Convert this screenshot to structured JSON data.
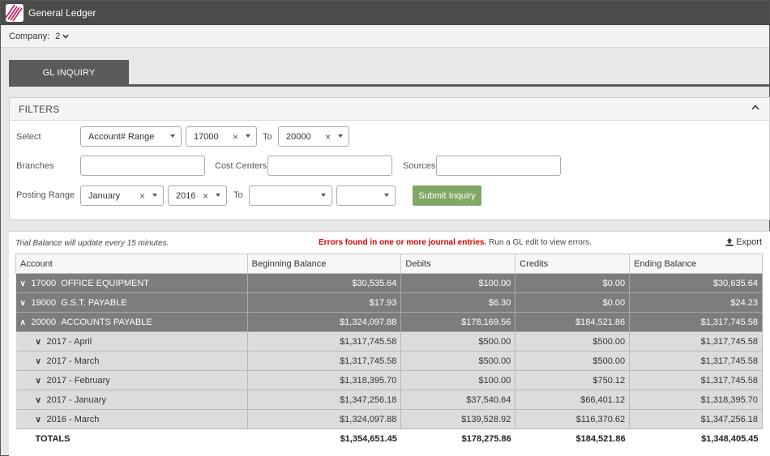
{
  "app": {
    "title": "General Ledger"
  },
  "company": {
    "label": "Company:",
    "value": "2"
  },
  "tabs": [
    {
      "label": "GL INQUIRY"
    }
  ],
  "filters": {
    "title": "FILTERS",
    "select_label": "Select",
    "select_type": "Account# Range",
    "from_value": "17000",
    "to_label": "To",
    "to_value": "20000",
    "branches_label": "Branches",
    "branches_value": "",
    "cost_centers_label": "Cost Centers",
    "cost_centers_value": "",
    "sources_label": "Sources",
    "sources_value": "",
    "posting_range_label": "Posting Range",
    "posting_month": "January",
    "posting_year": "2016",
    "posting_to_label": "To",
    "posting_to_month": "",
    "posting_to_year": "",
    "submit_label": "Submit Inquiry",
    "clear_glyph": "×"
  },
  "results": {
    "info_text": "Trial Balance will update every 15 minutes.",
    "error_text": "Errors found in one or more journal entries.",
    "error_rest": " Run a GL edit to view errors.",
    "export_label": "Export",
    "columns": [
      "Account",
      "Beginning Balance",
      "Debits",
      "Credits",
      "Ending Balance"
    ],
    "rows": [
      {
        "account": "17000",
        "name": "OFFICE EQUIPMENT",
        "beginning": "$30,535.64",
        "debits": "$100.00",
        "credits": "$0.00",
        "ending": "$30,635.64"
      },
      {
        "account": "19000",
        "name": "G.S.T. PAYABLE",
        "beginning": "$17.93",
        "debits": "$6.30",
        "credits": "$0.00",
        "ending": "$24.23"
      },
      {
        "account": "20000",
        "name": "ACCOUNTS PAYABLE",
        "beginning": "$1,324,097.88",
        "debits": "$178,169.56",
        "credits": "$184,521.86",
        "ending": "$1,317,745.58"
      }
    ],
    "months": [
      {
        "period": "2017 - April",
        "beginning": "$1,317,745.58",
        "debits": "$500.00",
        "credits": "$500.00",
        "ending": "$1,317,745.58"
      },
      {
        "period": "2017 - March",
        "beginning": "$1,317,745.58",
        "debits": "$500.00",
        "credits": "$500.00",
        "ending": "$1,317,745.58"
      },
      {
        "period": "2017 - February",
        "beginning": "$1,318,395.70",
        "debits": "$100.00",
        "credits": "$750.12",
        "ending": "$1,317,745.58"
      },
      {
        "period": "2017 - January",
        "beginning": "$1,347,256.18",
        "debits": "$37,540.64",
        "credits": "$66,401.12",
        "ending": "$1,318,395.70"
      },
      {
        "period": "2016 - March",
        "beginning": "$1,324,097.88",
        "debits": "$139,528.92",
        "credits": "$116,370.62",
        "ending": "$1,347,256.18"
      }
    ],
    "totals": {
      "label": "TOTALS",
      "beginning": "$1,354,651.45",
      "debits": "$178,275.86",
      "credits": "$184,521.86",
      "ending": "$1,348,405.45"
    }
  }
}
